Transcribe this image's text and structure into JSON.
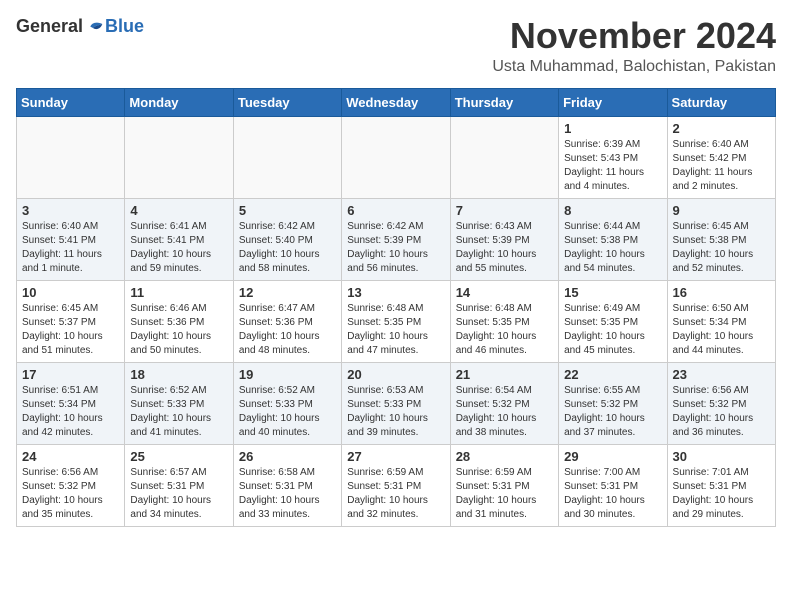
{
  "logo": {
    "general": "General",
    "blue": "Blue"
  },
  "title": "November 2024",
  "location": "Usta Muhammad, Balochistan, Pakistan",
  "headers": [
    "Sunday",
    "Monday",
    "Tuesday",
    "Wednesday",
    "Thursday",
    "Friday",
    "Saturday"
  ],
  "weeks": [
    [
      {
        "day": "",
        "info": ""
      },
      {
        "day": "",
        "info": ""
      },
      {
        "day": "",
        "info": ""
      },
      {
        "day": "",
        "info": ""
      },
      {
        "day": "",
        "info": ""
      },
      {
        "day": "1",
        "info": "Sunrise: 6:39 AM\nSunset: 5:43 PM\nDaylight: 11 hours\nand 4 minutes."
      },
      {
        "day": "2",
        "info": "Sunrise: 6:40 AM\nSunset: 5:42 PM\nDaylight: 11 hours\nand 2 minutes."
      }
    ],
    [
      {
        "day": "3",
        "info": "Sunrise: 6:40 AM\nSunset: 5:41 PM\nDaylight: 11 hours\nand 1 minute."
      },
      {
        "day": "4",
        "info": "Sunrise: 6:41 AM\nSunset: 5:41 PM\nDaylight: 10 hours\nand 59 minutes."
      },
      {
        "day": "5",
        "info": "Sunrise: 6:42 AM\nSunset: 5:40 PM\nDaylight: 10 hours\nand 58 minutes."
      },
      {
        "day": "6",
        "info": "Sunrise: 6:42 AM\nSunset: 5:39 PM\nDaylight: 10 hours\nand 56 minutes."
      },
      {
        "day": "7",
        "info": "Sunrise: 6:43 AM\nSunset: 5:39 PM\nDaylight: 10 hours\nand 55 minutes."
      },
      {
        "day": "8",
        "info": "Sunrise: 6:44 AM\nSunset: 5:38 PM\nDaylight: 10 hours\nand 54 minutes."
      },
      {
        "day": "9",
        "info": "Sunrise: 6:45 AM\nSunset: 5:38 PM\nDaylight: 10 hours\nand 52 minutes."
      }
    ],
    [
      {
        "day": "10",
        "info": "Sunrise: 6:45 AM\nSunset: 5:37 PM\nDaylight: 10 hours\nand 51 minutes."
      },
      {
        "day": "11",
        "info": "Sunrise: 6:46 AM\nSunset: 5:36 PM\nDaylight: 10 hours\nand 50 minutes."
      },
      {
        "day": "12",
        "info": "Sunrise: 6:47 AM\nSunset: 5:36 PM\nDaylight: 10 hours\nand 48 minutes."
      },
      {
        "day": "13",
        "info": "Sunrise: 6:48 AM\nSunset: 5:35 PM\nDaylight: 10 hours\nand 47 minutes."
      },
      {
        "day": "14",
        "info": "Sunrise: 6:48 AM\nSunset: 5:35 PM\nDaylight: 10 hours\nand 46 minutes."
      },
      {
        "day": "15",
        "info": "Sunrise: 6:49 AM\nSunset: 5:35 PM\nDaylight: 10 hours\nand 45 minutes."
      },
      {
        "day": "16",
        "info": "Sunrise: 6:50 AM\nSunset: 5:34 PM\nDaylight: 10 hours\nand 44 minutes."
      }
    ],
    [
      {
        "day": "17",
        "info": "Sunrise: 6:51 AM\nSunset: 5:34 PM\nDaylight: 10 hours\nand 42 minutes."
      },
      {
        "day": "18",
        "info": "Sunrise: 6:52 AM\nSunset: 5:33 PM\nDaylight: 10 hours\nand 41 minutes."
      },
      {
        "day": "19",
        "info": "Sunrise: 6:52 AM\nSunset: 5:33 PM\nDaylight: 10 hours\nand 40 minutes."
      },
      {
        "day": "20",
        "info": "Sunrise: 6:53 AM\nSunset: 5:33 PM\nDaylight: 10 hours\nand 39 minutes."
      },
      {
        "day": "21",
        "info": "Sunrise: 6:54 AM\nSunset: 5:32 PM\nDaylight: 10 hours\nand 38 minutes."
      },
      {
        "day": "22",
        "info": "Sunrise: 6:55 AM\nSunset: 5:32 PM\nDaylight: 10 hours\nand 37 minutes."
      },
      {
        "day": "23",
        "info": "Sunrise: 6:56 AM\nSunset: 5:32 PM\nDaylight: 10 hours\nand 36 minutes."
      }
    ],
    [
      {
        "day": "24",
        "info": "Sunrise: 6:56 AM\nSunset: 5:32 PM\nDaylight: 10 hours\nand 35 minutes."
      },
      {
        "day": "25",
        "info": "Sunrise: 6:57 AM\nSunset: 5:31 PM\nDaylight: 10 hours\nand 34 minutes."
      },
      {
        "day": "26",
        "info": "Sunrise: 6:58 AM\nSunset: 5:31 PM\nDaylight: 10 hours\nand 33 minutes."
      },
      {
        "day": "27",
        "info": "Sunrise: 6:59 AM\nSunset: 5:31 PM\nDaylight: 10 hours\nand 32 minutes."
      },
      {
        "day": "28",
        "info": "Sunrise: 6:59 AM\nSunset: 5:31 PM\nDaylight: 10 hours\nand 31 minutes."
      },
      {
        "day": "29",
        "info": "Sunrise: 7:00 AM\nSunset: 5:31 PM\nDaylight: 10 hours\nand 30 minutes."
      },
      {
        "day": "30",
        "info": "Sunrise: 7:01 AM\nSunset: 5:31 PM\nDaylight: 10 hours\nand 29 minutes."
      }
    ]
  ]
}
